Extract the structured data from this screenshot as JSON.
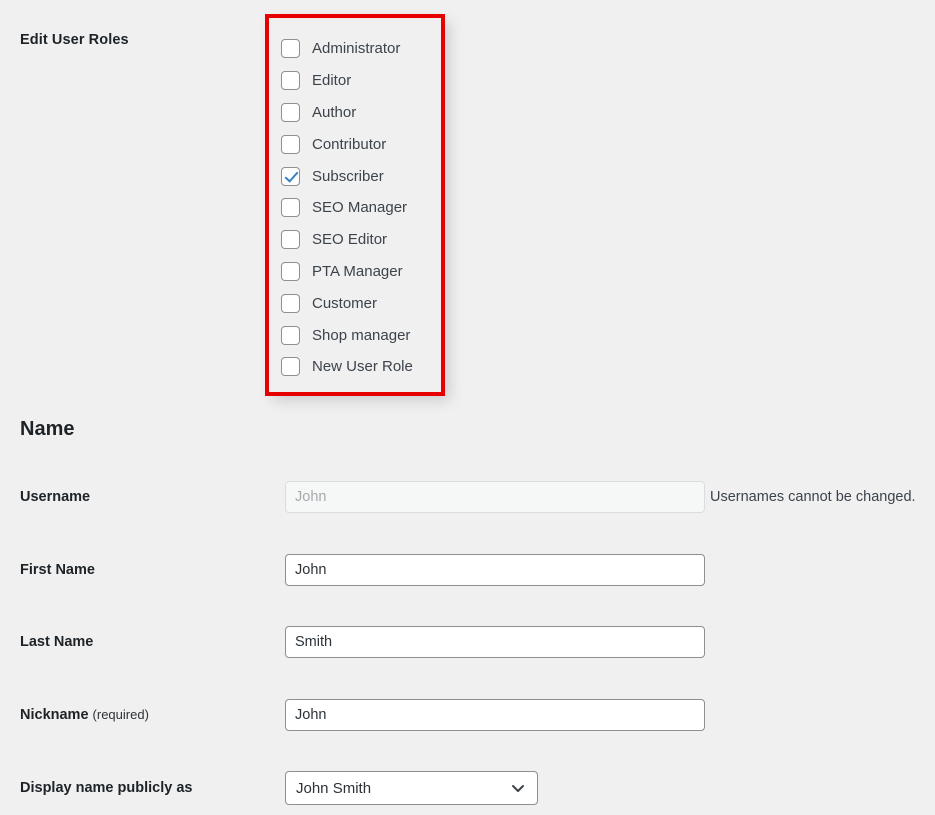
{
  "roles_section": {
    "label": "Edit User Roles",
    "annotation_color": "#e60000",
    "roles": [
      {
        "label": "Administrator",
        "checked": false
      },
      {
        "label": "Editor",
        "checked": false
      },
      {
        "label": "Author",
        "checked": false
      },
      {
        "label": "Contributor",
        "checked": false
      },
      {
        "label": "Subscriber",
        "checked": true
      },
      {
        "label": "SEO Manager",
        "checked": false
      },
      {
        "label": "SEO Editor",
        "checked": false
      },
      {
        "label": "PTA Manager",
        "checked": false
      },
      {
        "label": "Customer",
        "checked": false
      },
      {
        "label": "Shop manager",
        "checked": false
      },
      {
        "label": "New User Role",
        "checked": false
      }
    ]
  },
  "name_section": {
    "heading": "Name",
    "fields": {
      "username": {
        "label": "Username",
        "value": "",
        "placeholder": "John",
        "helper": "Usernames cannot be changed."
      },
      "first_name": {
        "label": "First Name",
        "value": "John",
        "placeholder": ""
      },
      "last_name": {
        "label": "Last Name",
        "value": "Smith",
        "placeholder": ""
      },
      "nickname": {
        "label": "Nickname",
        "required_note": "(required)",
        "value": "John",
        "placeholder": ""
      },
      "display_name": {
        "label": "Display name publicly as",
        "selected": "John Smith",
        "options": [
          "John Smith"
        ],
        "chevron": "chevron-down-icon"
      }
    }
  }
}
